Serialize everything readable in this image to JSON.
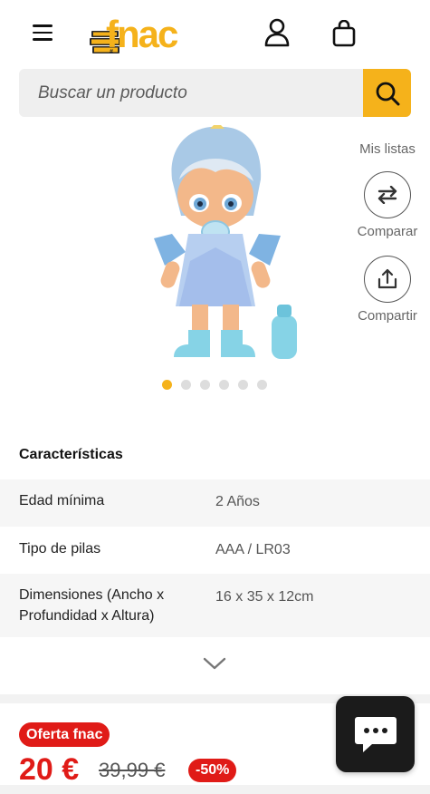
{
  "header": {
    "logo_text": "fnac",
    "colors": {
      "brand_yellow": "#f5b21b",
      "accent_red": "#e01b17"
    }
  },
  "search": {
    "placeholder": "Buscar un producto"
  },
  "side_actions": {
    "lists_label": "Mis listas",
    "compare_label": "Comparar",
    "share_label": "Compartir"
  },
  "gallery": {
    "total_images": 6,
    "active_index": 0
  },
  "specs": {
    "title": "Características",
    "rows": [
      {
        "key": "Edad mínima",
        "value": "2 Años"
      },
      {
        "key": "Tipo de pilas",
        "value": "AAA / LR03"
      },
      {
        "key": "Dimensiones (Ancho x Profundidad x Altura)",
        "value": "16 x 35 x 12cm"
      }
    ]
  },
  "pricing": {
    "offer_label": "Oferta fnac",
    "price": "20 €",
    "old_price": "39,99 €",
    "discount": "-50%"
  },
  "icons": [
    "menu-icon",
    "user-icon",
    "bag-icon",
    "search-icon",
    "compare-icon",
    "share-icon",
    "chevron-down-icon",
    "chat-icon"
  ]
}
